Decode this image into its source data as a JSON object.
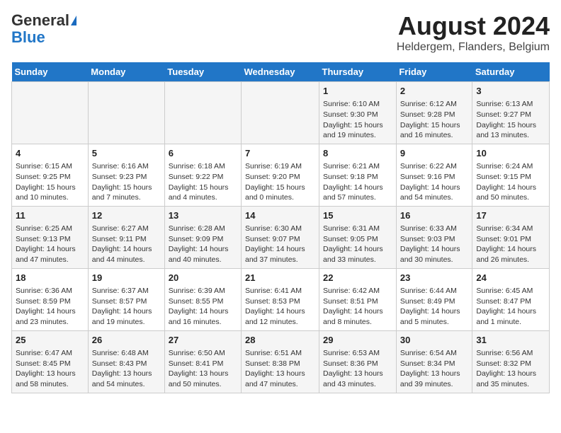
{
  "header": {
    "logo_general": "General",
    "logo_blue": "Blue",
    "title": "August 2024",
    "subtitle": "Heldergem, Flanders, Belgium"
  },
  "calendar": {
    "weekdays": [
      "Sunday",
      "Monday",
      "Tuesday",
      "Wednesday",
      "Thursday",
      "Friday",
      "Saturday"
    ],
    "weeks": [
      [
        {
          "day": "",
          "info": ""
        },
        {
          "day": "",
          "info": ""
        },
        {
          "day": "",
          "info": ""
        },
        {
          "day": "",
          "info": ""
        },
        {
          "day": "1",
          "info": "Sunrise: 6:10 AM\nSunset: 9:30 PM\nDaylight: 15 hours and 19 minutes."
        },
        {
          "day": "2",
          "info": "Sunrise: 6:12 AM\nSunset: 9:28 PM\nDaylight: 15 hours and 16 minutes."
        },
        {
          "day": "3",
          "info": "Sunrise: 6:13 AM\nSunset: 9:27 PM\nDaylight: 15 hours and 13 minutes."
        }
      ],
      [
        {
          "day": "4",
          "info": "Sunrise: 6:15 AM\nSunset: 9:25 PM\nDaylight: 15 hours and 10 minutes."
        },
        {
          "day": "5",
          "info": "Sunrise: 6:16 AM\nSunset: 9:23 PM\nDaylight: 15 hours and 7 minutes."
        },
        {
          "day": "6",
          "info": "Sunrise: 6:18 AM\nSunset: 9:22 PM\nDaylight: 15 hours and 4 minutes."
        },
        {
          "day": "7",
          "info": "Sunrise: 6:19 AM\nSunset: 9:20 PM\nDaylight: 15 hours and 0 minutes."
        },
        {
          "day": "8",
          "info": "Sunrise: 6:21 AM\nSunset: 9:18 PM\nDaylight: 14 hours and 57 minutes."
        },
        {
          "day": "9",
          "info": "Sunrise: 6:22 AM\nSunset: 9:16 PM\nDaylight: 14 hours and 54 minutes."
        },
        {
          "day": "10",
          "info": "Sunrise: 6:24 AM\nSunset: 9:15 PM\nDaylight: 14 hours and 50 minutes."
        }
      ],
      [
        {
          "day": "11",
          "info": "Sunrise: 6:25 AM\nSunset: 9:13 PM\nDaylight: 14 hours and 47 minutes."
        },
        {
          "day": "12",
          "info": "Sunrise: 6:27 AM\nSunset: 9:11 PM\nDaylight: 14 hours and 44 minutes."
        },
        {
          "day": "13",
          "info": "Sunrise: 6:28 AM\nSunset: 9:09 PM\nDaylight: 14 hours and 40 minutes."
        },
        {
          "day": "14",
          "info": "Sunrise: 6:30 AM\nSunset: 9:07 PM\nDaylight: 14 hours and 37 minutes."
        },
        {
          "day": "15",
          "info": "Sunrise: 6:31 AM\nSunset: 9:05 PM\nDaylight: 14 hours and 33 minutes."
        },
        {
          "day": "16",
          "info": "Sunrise: 6:33 AM\nSunset: 9:03 PM\nDaylight: 14 hours and 30 minutes."
        },
        {
          "day": "17",
          "info": "Sunrise: 6:34 AM\nSunset: 9:01 PM\nDaylight: 14 hours and 26 minutes."
        }
      ],
      [
        {
          "day": "18",
          "info": "Sunrise: 6:36 AM\nSunset: 8:59 PM\nDaylight: 14 hours and 23 minutes."
        },
        {
          "day": "19",
          "info": "Sunrise: 6:37 AM\nSunset: 8:57 PM\nDaylight: 14 hours and 19 minutes."
        },
        {
          "day": "20",
          "info": "Sunrise: 6:39 AM\nSunset: 8:55 PM\nDaylight: 14 hours and 16 minutes."
        },
        {
          "day": "21",
          "info": "Sunrise: 6:41 AM\nSunset: 8:53 PM\nDaylight: 14 hours and 12 minutes."
        },
        {
          "day": "22",
          "info": "Sunrise: 6:42 AM\nSunset: 8:51 PM\nDaylight: 14 hours and 8 minutes."
        },
        {
          "day": "23",
          "info": "Sunrise: 6:44 AM\nSunset: 8:49 PM\nDaylight: 14 hours and 5 minutes."
        },
        {
          "day": "24",
          "info": "Sunrise: 6:45 AM\nSunset: 8:47 PM\nDaylight: 14 hours and 1 minute."
        }
      ],
      [
        {
          "day": "25",
          "info": "Sunrise: 6:47 AM\nSunset: 8:45 PM\nDaylight: 13 hours and 58 minutes."
        },
        {
          "day": "26",
          "info": "Sunrise: 6:48 AM\nSunset: 8:43 PM\nDaylight: 13 hours and 54 minutes."
        },
        {
          "day": "27",
          "info": "Sunrise: 6:50 AM\nSunset: 8:41 PM\nDaylight: 13 hours and 50 minutes."
        },
        {
          "day": "28",
          "info": "Sunrise: 6:51 AM\nSunset: 8:38 PM\nDaylight: 13 hours and 47 minutes."
        },
        {
          "day": "29",
          "info": "Sunrise: 6:53 AM\nSunset: 8:36 PM\nDaylight: 13 hours and 43 minutes."
        },
        {
          "day": "30",
          "info": "Sunrise: 6:54 AM\nSunset: 8:34 PM\nDaylight: 13 hours and 39 minutes."
        },
        {
          "day": "31",
          "info": "Sunrise: 6:56 AM\nSunset: 8:32 PM\nDaylight: 13 hours and 35 minutes."
        }
      ]
    ]
  }
}
